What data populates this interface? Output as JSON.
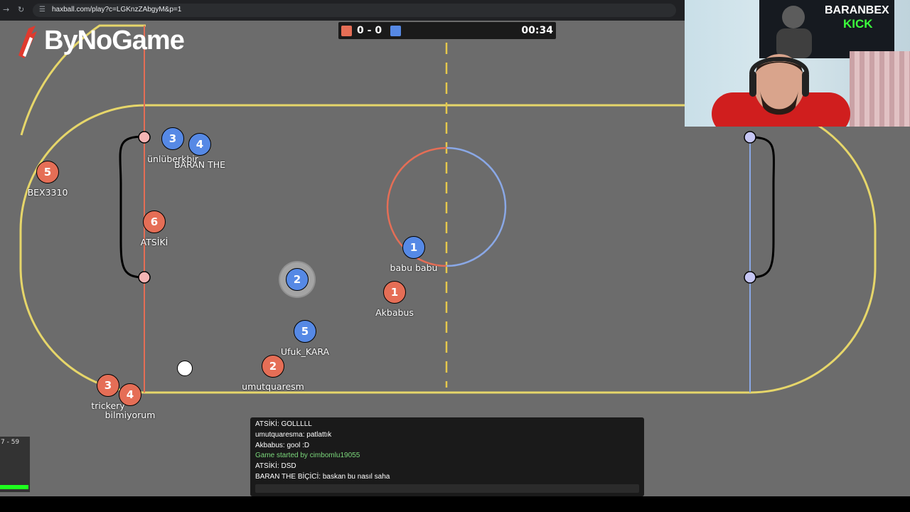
{
  "browser": {
    "url": "haxball.com/play?c=LGKnzZAbgyM&p=1"
  },
  "logo": {
    "text": "ByNoGame"
  },
  "scoreboard": {
    "red_score": "0",
    "separator": "-",
    "blue_score": "0",
    "time": "00:34",
    "red_color": "#e56e56",
    "blue_color": "#5689e5"
  },
  "players": [
    {
      "team": "red",
      "number": "5",
      "name": "BEX3310"
    },
    {
      "team": "blue",
      "number": "3",
      "name": "ünlüberkbir"
    },
    {
      "team": "blue",
      "number": "4",
      "name": "BARAN THE"
    },
    {
      "team": "red",
      "number": "6",
      "name": "ATSİKİ"
    },
    {
      "team": "blue",
      "number": "2",
      "name": ""
    },
    {
      "team": "blue",
      "number": "1",
      "name": "babu babu"
    },
    {
      "team": "red",
      "number": "1",
      "name": "Akbabus"
    },
    {
      "team": "blue",
      "number": "5",
      "name": "Ufuk_KARA"
    },
    {
      "team": "red",
      "number": "2",
      "name": "umutquaresm"
    },
    {
      "team": "red",
      "number": "3",
      "name": "trickery"
    },
    {
      "team": "red",
      "number": "4",
      "name": "bilmiyorum"
    }
  ],
  "chat": {
    "lines": [
      {
        "text": "ATSİKİ: GOLLLLL",
        "system": false
      },
      {
        "text": "umutquaresma: patlattık",
        "system": false
      },
      {
        "text": "Akbabus: gool :D",
        "system": false
      },
      {
        "text": "Game started by cimbomlu19055",
        "system": true
      },
      {
        "text": "ATSİKİ: DSD",
        "system": false
      },
      {
        "text": "BARAN THE BİÇİCİ: baskan bu nasıl saha",
        "system": false
      }
    ]
  },
  "stats": {
    "text": "7 - 59"
  },
  "webcam": {
    "banner_line1": "BARANBEX",
    "banner_line2": "KICK"
  },
  "colors": {
    "field": "#6c6c6c",
    "boundary": "#e6d66a",
    "red_line": "#e56e56",
    "blue_line": "#8aa8e6",
    "midline": "#e6c84c"
  }
}
